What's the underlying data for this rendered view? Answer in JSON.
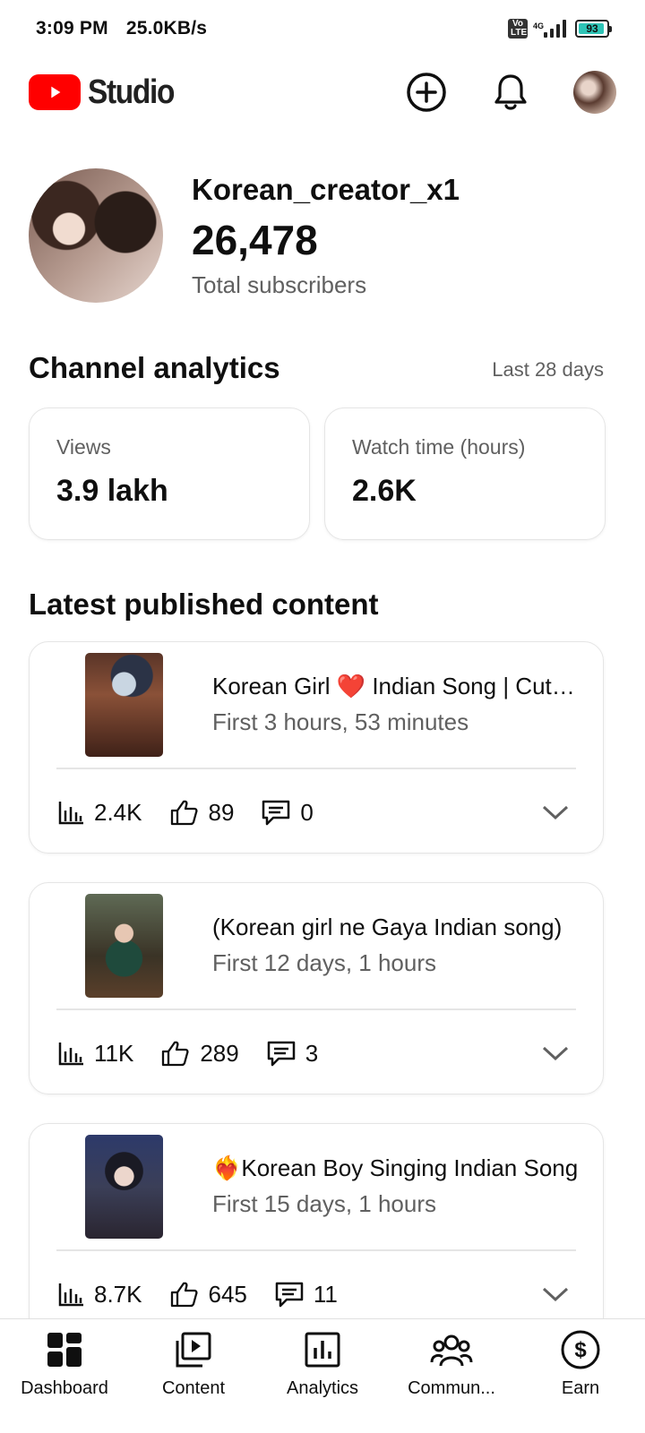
{
  "status_bar": {
    "time": "3:09 PM",
    "speed": "25.0KB/s",
    "volte": "Vo LTE",
    "network": "4G",
    "battery": "93",
    "battery_level": 0.93
  },
  "header": {
    "logo_text": "Studio",
    "icons": [
      "create-icon",
      "notifications-icon",
      "account-avatar"
    ]
  },
  "profile": {
    "channel_name": "Korean_creator_x1",
    "subscribers": "26,478",
    "subscribers_label": "Total subscribers"
  },
  "analytics": {
    "title": "Channel analytics",
    "period": "Last 28 days",
    "metrics": [
      {
        "label": "Views",
        "value": "3.9 lakh"
      },
      {
        "label": "Watch time (hours)",
        "value": "2.6K"
      }
    ]
  },
  "latest": {
    "title": "Latest published content",
    "items": [
      {
        "title": "Korean Girl ❤️ Indian Song | Cute Voice",
        "subtitle": "First 3 hours, 53 minutes",
        "views": "2.4K",
        "likes": "89",
        "comments": "0"
      },
      {
        "title": "(Korean girl ne Gaya Indian song)",
        "subtitle": "First 12 days, 1 hours",
        "views": "11K",
        "likes": "289",
        "comments": "3"
      },
      {
        "title": "❤️‍🔥Korean Boy Singing Indian Song",
        "subtitle": "First 15 days, 1 hours",
        "views": "8.7K",
        "likes": "645",
        "comments": "11"
      }
    ]
  },
  "bottom_nav": {
    "items": [
      {
        "label": "Dashboard",
        "icon": "dashboard-icon"
      },
      {
        "label": "Content",
        "icon": "content-icon"
      },
      {
        "label": "Analytics",
        "icon": "analytics-icon"
      },
      {
        "label": "Commun...",
        "icon": "community-icon"
      },
      {
        "label": "Earn",
        "icon": "earn-icon"
      }
    ]
  },
  "colors": {
    "brand_red": "#ff0000",
    "text_primary": "#0f0f0f",
    "text_secondary": "#606060",
    "battery": "#2ec4b6"
  }
}
